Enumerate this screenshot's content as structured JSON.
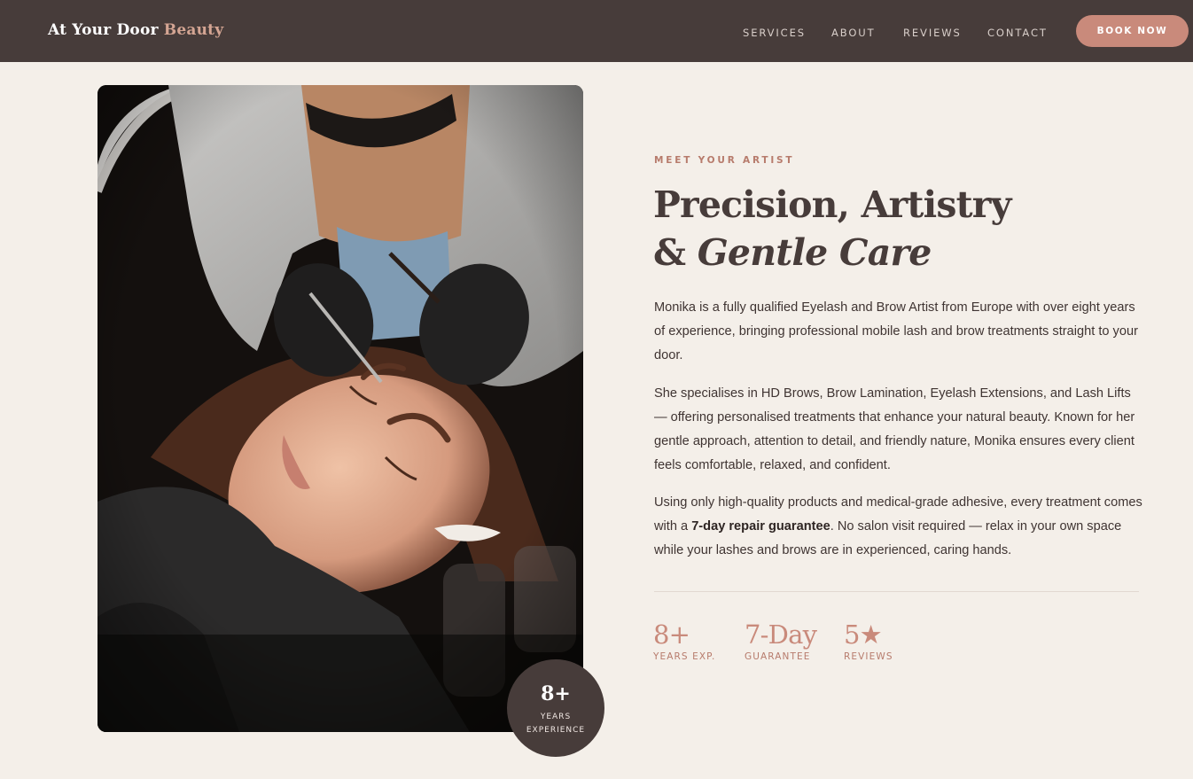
{
  "nav": {
    "brand_main": "At Your Door",
    "brand_accent": "Beauty",
    "links": [
      "SERVICES",
      "ABOUT",
      "REVIEWS",
      "CONTACT"
    ],
    "cta": "BOOK NOW"
  },
  "badge": {
    "number": "8+",
    "line1": "YEARS",
    "line2": "EXPERIENCE"
  },
  "about": {
    "eyebrow": "MEET YOUR ARTIST",
    "heading_line1": "Precision, Artistry",
    "heading_amp": "& ",
    "heading_italic": "Gentle Care",
    "paragraph1": "Monika is a fully qualified Eyelash and Brow Artist from Europe with over eight years of experience, bringing professional mobile lash and brow treatments straight to your door.",
    "paragraph2": "She specialises in HD Brows, Brow Lamination, Eyelash Extensions, and Lash Lifts — offering personalised treatments that enhance your natural beauty. Known for her gentle approach, attention to detail, and friendly nature, Monika ensures every client feels comfortable, relaxed, and confident.",
    "paragraph3_before": "Using only high-quality products and medical-grade adhesive, every treatment comes with a ",
    "paragraph3_bold": "7-day repair guarantee",
    "paragraph3_after": ". No salon visit required — relax in your own space while your lashes and brows are in experienced, caring hands."
  },
  "stats": [
    {
      "value": "8+",
      "label": "YEARS EXP."
    },
    {
      "value": "7-Day",
      "label": "GUARANTEE"
    },
    {
      "value": "5★",
      "label": "REVIEWS"
    }
  ],
  "colors": {
    "nav_bg": "#473c3a",
    "page_bg": "#f4efe9",
    "accent": "#c98a7b",
    "heading": "#473c3a"
  }
}
